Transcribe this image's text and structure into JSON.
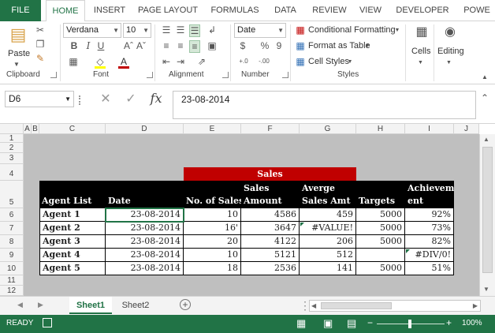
{
  "ribbon_tabs": [
    "FILE",
    "HOME",
    "INSERT",
    "PAGE LAYOUT",
    "FORMULAS",
    "DATA",
    "REVIEW",
    "VIEW",
    "DEVELOPER",
    "POWE"
  ],
  "clipboard": {
    "paste_label": "Paste",
    "group_label": "Clipboard"
  },
  "font": {
    "name": "Verdana",
    "size": "10",
    "group_label": "Font",
    "bold": "B",
    "italic": "I",
    "underline": "U",
    "font_color": "#c00000",
    "fill_color": "#ffff00"
  },
  "alignment": {
    "group_label": "Alignment"
  },
  "number": {
    "format": "Date",
    "currency": "$",
    "percent": "%",
    "comma": "9",
    "inc_decimal": "+.0",
    "dec_decimal": "-.00",
    "group_label": "Number"
  },
  "styles": {
    "conditional": "Conditional Formatting",
    "format_table": "Format as Table",
    "cell_styles": "Cell Styles",
    "group_label": "Styles"
  },
  "cells": {
    "label": "Cells"
  },
  "editing": {
    "label": "Editing"
  },
  "formula_bar": {
    "name_box": "D6",
    "formula": "23-08-2014",
    "cancel": "✕",
    "enter": "✓",
    "fx": "fx"
  },
  "columns": [
    "A",
    "B",
    "C",
    "D",
    "E",
    "F",
    "G",
    "H",
    "I",
    "J"
  ],
  "rows": [
    "1",
    "2",
    "3",
    "4",
    "5",
    "6",
    "7",
    "8",
    "9",
    "10",
    "11",
    "12"
  ],
  "sales_header": "Sales",
  "table_headers": [
    "Agent List",
    "Date",
    "No. of Sales",
    "Sales Amount",
    "Averge Sales Amt",
    "Targets",
    "Achievement"
  ],
  "table_headers_top": [
    "",
    "",
    "",
    "Sales",
    "Averge",
    "",
    "Achievem"
  ],
  "table_headers_bottom": [
    "Agent List",
    "Date",
    "No. of Sales",
    "Amount",
    "Sales Amt",
    "Targets",
    "ent"
  ],
  "table_rows": [
    [
      "Agent 1",
      "23-08-2014",
      "10",
      "4586",
      "459",
      "5000",
      "92%"
    ],
    [
      "Agent 2",
      "23-08-2014",
      "16'",
      "3647",
      "#VALUE!",
      "5000",
      "73%"
    ],
    [
      "Agent 3",
      "23-08-2014",
      "20",
      "4122",
      "206",
      "5000",
      "82%"
    ],
    [
      "Agent 4",
      "23-08-2014",
      "10",
      "5121",
      "512",
      "",
      "#DIV/0!"
    ],
    [
      "Agent 5",
      "23-08-2014",
      "18",
      "2536",
      "141",
      "5000",
      "51%"
    ]
  ],
  "sheets": [
    "Sheet1",
    "Sheet2"
  ],
  "status": {
    "ready": "READY",
    "zoom": "100%"
  }
}
